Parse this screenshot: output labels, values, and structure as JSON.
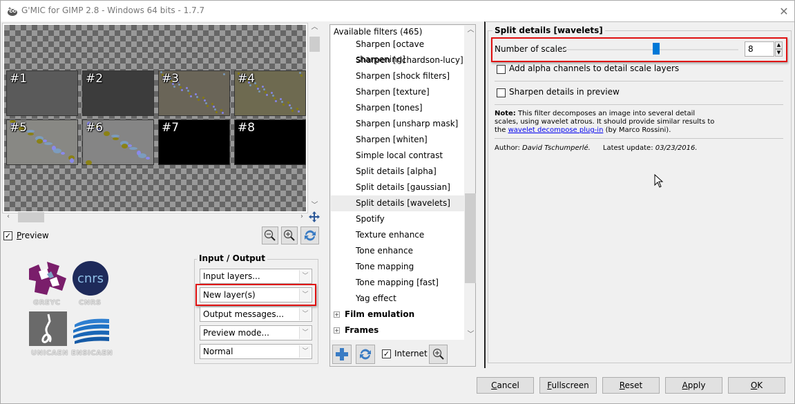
{
  "window": {
    "title": "G'MIC for GIMP 2.8 - Windows 64 bits - 1.7.7",
    "app_icon": "gimp-wilber-icon",
    "close_icon": "close-icon"
  },
  "preview": {
    "thumbnails": [
      {
        "label": "#1",
        "color": "#5a5a5a"
      },
      {
        "label": "#2",
        "color": "#3c3c3c"
      },
      {
        "label": "#3",
        "color": "#6a6558"
      },
      {
        "label": "#4",
        "color": "#6e6a50"
      },
      {
        "label": "#5",
        "color": "#888884"
      },
      {
        "label": "#6",
        "color": "#858585"
      },
      {
        "label": "#7",
        "color": "#000000"
      },
      {
        "label": "#8",
        "color": "#000000"
      }
    ],
    "preview_checkbox_label": "Preview",
    "preview_checked": true,
    "zoom_out_icon": "zoom-out-icon",
    "zoom_in_icon": "zoom-in-icon",
    "refresh_icon": "refresh-icon",
    "move_icon": "move-icon"
  },
  "logos": [
    {
      "name": "GREYC"
    },
    {
      "name": "CNRS"
    },
    {
      "name": "UNICAEN"
    },
    {
      "name": "ENSICAEN"
    }
  ],
  "io": {
    "title": "Input / Output",
    "combos": [
      {
        "value": "Input layers...",
        "highlighted": false
      },
      {
        "value": "New layer(s)",
        "highlighted": true
      },
      {
        "value": "Output messages...",
        "highlighted": false
      },
      {
        "value": "Preview mode...",
        "highlighted": false
      },
      {
        "value": "Normal",
        "highlighted": false
      }
    ]
  },
  "filters": {
    "header": "Available filters (465)",
    "items": [
      {
        "label": "Sharpen [octave sharpening]",
        "type": "filter"
      },
      {
        "label": "Sharpen [richardson-lucy]",
        "type": "filter"
      },
      {
        "label": "Sharpen [shock filters]",
        "type": "filter"
      },
      {
        "label": "Sharpen [texture]",
        "type": "filter"
      },
      {
        "label": "Sharpen [tones]",
        "type": "filter"
      },
      {
        "label": "Sharpen [unsharp mask]",
        "type": "filter"
      },
      {
        "label": "Sharpen [whiten]",
        "type": "filter"
      },
      {
        "label": "Simple local contrast",
        "type": "filter"
      },
      {
        "label": "Split details [alpha]",
        "type": "filter"
      },
      {
        "label": "Split details [gaussian]",
        "type": "filter"
      },
      {
        "label": "Split details [wavelets]",
        "type": "filter",
        "selected": true
      },
      {
        "label": "Spotify",
        "type": "filter"
      },
      {
        "label": "Texture enhance",
        "type": "filter"
      },
      {
        "label": "Tone enhance",
        "type": "filter"
      },
      {
        "label": "Tone mapping",
        "type": "filter"
      },
      {
        "label": "Tone mapping [fast]",
        "type": "filter"
      },
      {
        "label": "Yag effect",
        "type": "filter"
      },
      {
        "label": "Film emulation",
        "type": "category"
      },
      {
        "label": "Frames",
        "type": "category"
      }
    ],
    "internet_label": "Internet",
    "internet_checked": true,
    "add_icon": "add-fave-icon",
    "refresh_icon": "refresh-icon",
    "search_icon": "zoom-in-icon"
  },
  "settings": {
    "title": "Split details [wavelets]",
    "number_of_scales_label": "Number of scales",
    "number_of_scales_value": "8",
    "slider_fraction": 0.53,
    "alpha_label": "Add alpha channels to detail scale layers",
    "alpha_checked": false,
    "sharpen_label": "Sharpen details in preview",
    "sharpen_checked": false,
    "note_bold": "Note:",
    "note_line1": " This filter decomposes an image into several detail",
    "note_line2": "scales, using wavelet atrous. It should provide similar results to",
    "note_line3_pre": "the ",
    "note_link": "wavelet decompose plug-in",
    "note_line3_post": " (by Marco Rossini).",
    "author_label": "Author: ",
    "author_name": "David Tschumperlé.",
    "update_label": "Latest update: ",
    "update_date": "03/23/2016."
  },
  "buttons": {
    "cancel": {
      "accel": "C",
      "rest": "ancel"
    },
    "fullscreen": {
      "accel": "F",
      "rest": "ullscreen"
    },
    "reset": {
      "accel": "R",
      "rest": "eset"
    },
    "apply": {
      "accel": "A",
      "rest": "pply"
    },
    "ok": {
      "accel": "O",
      "rest": "K"
    }
  },
  "colors": {
    "highlight_box": "#e01010",
    "slider_handle": "#0078d7",
    "link": "#0000ee"
  }
}
